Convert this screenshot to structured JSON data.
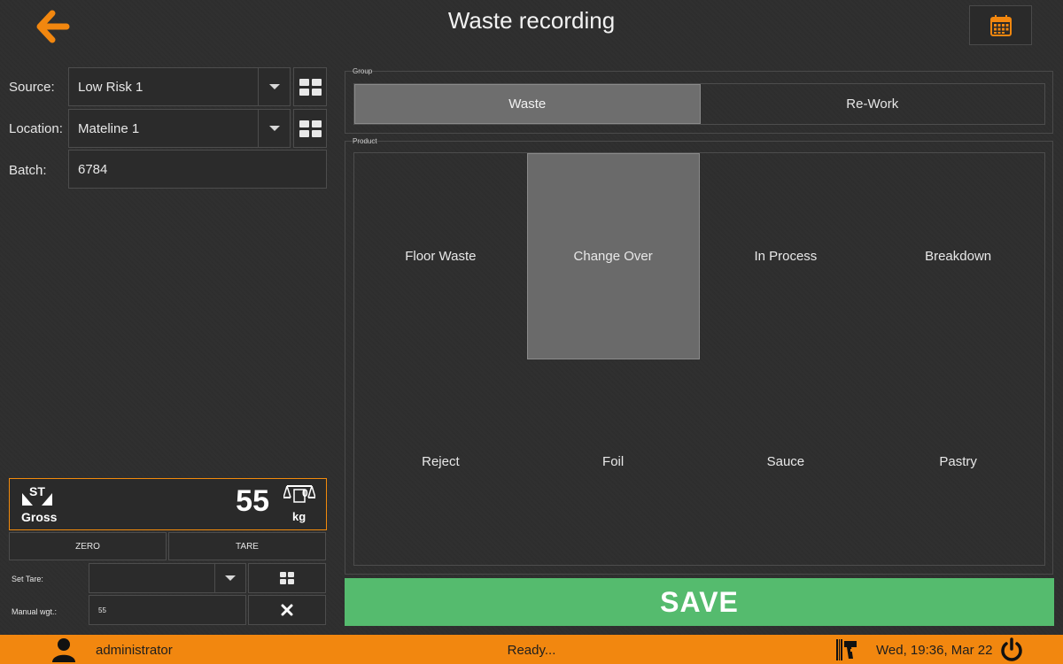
{
  "header": {
    "title": "Waste recording"
  },
  "form": {
    "source_label": "Source:",
    "source_value": "Low Risk 1",
    "location_label": "Location:",
    "location_value": "Mateline 1",
    "batch_label": "Batch:",
    "batch_value": "6784"
  },
  "scale": {
    "mode_badge": "ST",
    "mode": "Gross",
    "weight": "55",
    "zero_indicator": "0",
    "unit": "kg",
    "zero_label": "ZERO",
    "tare_label": "TARE",
    "set_tare_label": "Set Tare:",
    "set_tare_value": "",
    "manual_wgt_label": "Manual wgt.:",
    "manual_wgt_value": "55"
  },
  "group": {
    "label": "Group",
    "options": [
      "Waste",
      "Re-Work"
    ],
    "selected": "Waste"
  },
  "product": {
    "label": "Product",
    "items": [
      "Floor Waste",
      "Change Over",
      "In Process",
      "Breakdown",
      "Reject",
      "Foil",
      "Sauce",
      "Pastry"
    ],
    "selected": "Change Over"
  },
  "save_label": "SAVE",
  "status_bar": {
    "user": "administrator",
    "status": "Ready...",
    "datetime": "Wed, 19:36, Mar 22"
  },
  "colors": {
    "accent": "#f2870f",
    "save": "#55bb6e",
    "selected": "#6e6e6e",
    "background": "#2e2e2e"
  },
  "icons": {
    "back": "arrow-left-icon",
    "calendar": "calendar-icon",
    "grid": "grid-icon",
    "clear": "close-icon",
    "user": "user-icon",
    "scanner": "barcode-scanner-icon",
    "power": "power-icon"
  }
}
